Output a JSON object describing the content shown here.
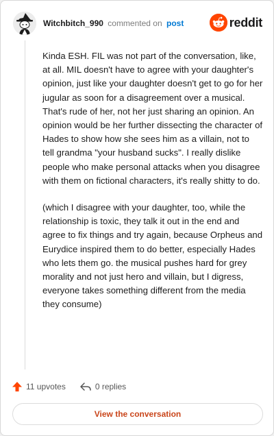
{
  "comment": {
    "username": "Witchbitch_990",
    "verb": "commented on",
    "post_link": "post",
    "paragraphs": [
      "Kinda ESH. FIL was not part of the conversation, like, at all. MIL doesn't have to agree with your daughter's opinion, just like your daughter doesn't get to go for her jugular as soon for a disagreement over a musical. That's rude of her, not her just sharing an opinion. An opinion would be her further dissecting the character of Hades to show how she sees him as a villain, not to tell grandma \"your husband sucks\". I really dislike people who make personal attacks when you disagree with them on fictional characters, it's really shitty to do.",
      "(which I disagree with your daughter, too, while the relationship is toxic, they talk it out in the end and agree to fix things and try again, because Orpheus and Eurydice inspired them to do better, especially Hades who lets them go. the musical pushes hard for grey morality and not just hero and villain, but I digress, everyone takes something different from the media they consume)"
    ]
  },
  "brand": {
    "wordmark": "reddit",
    "color": "#ff4500"
  },
  "footer": {
    "upvotes": "11 upvotes",
    "replies": "0 replies",
    "upvote_color": "#ff4500"
  },
  "cta": {
    "label": "View the conversation"
  },
  "icons": [
    "avatar",
    "reddit-logo-icon",
    "upvote-arrow-icon",
    "reply-icon"
  ]
}
